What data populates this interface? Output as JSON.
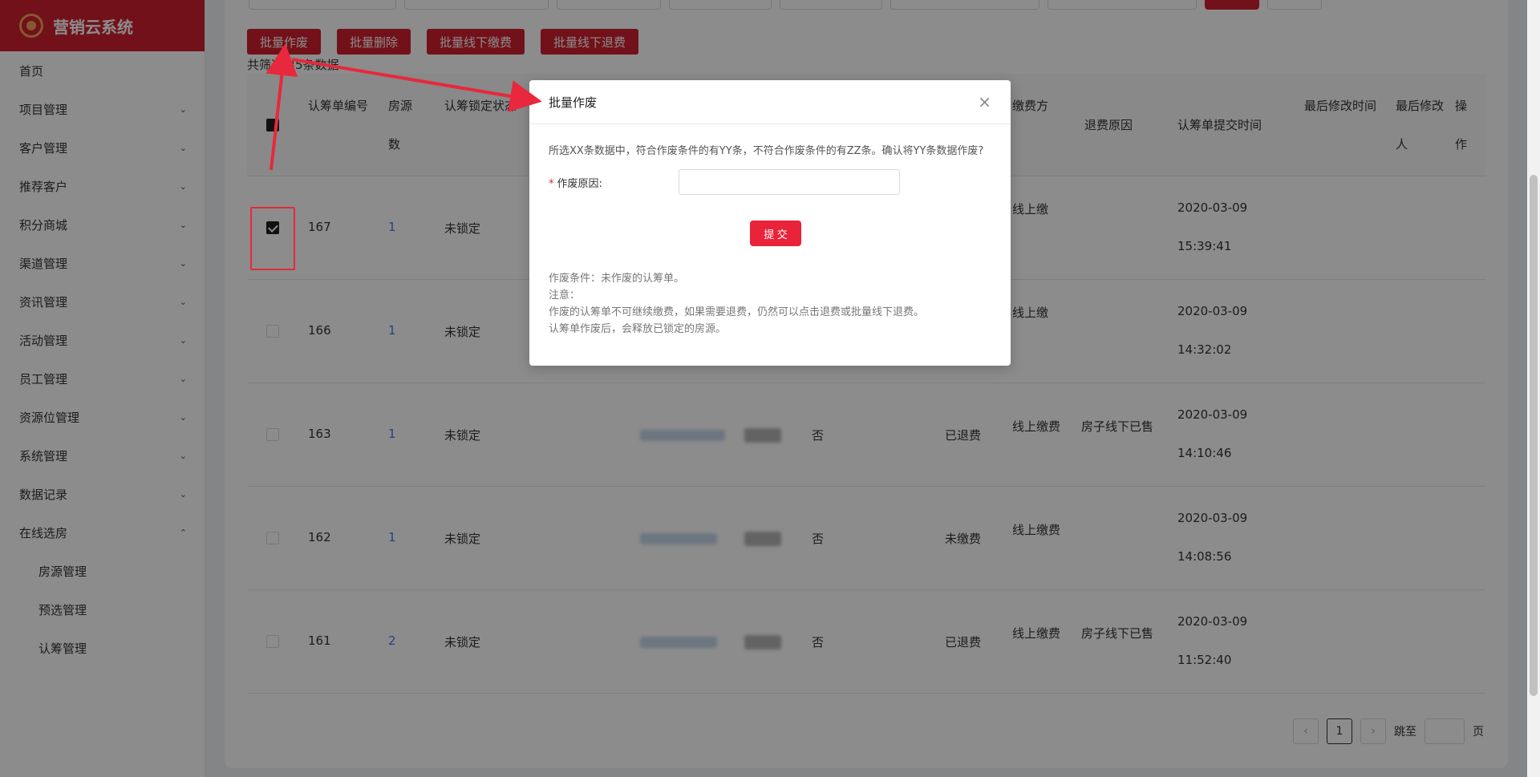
{
  "app": {
    "name": "营销云系统"
  },
  "sidebar": {
    "items": [
      {
        "label": "首页",
        "arrow": ""
      },
      {
        "label": "项目管理",
        "arrow": "⌄"
      },
      {
        "label": "客户管理",
        "arrow": "⌄"
      },
      {
        "label": "推荐客户",
        "arrow": "⌄"
      },
      {
        "label": "积分商城",
        "arrow": "⌄"
      },
      {
        "label": "渠道管理",
        "arrow": "⌄"
      },
      {
        "label": "资讯管理",
        "arrow": "⌄"
      },
      {
        "label": "活动管理",
        "arrow": "⌄"
      },
      {
        "label": "员工管理",
        "arrow": "⌄"
      },
      {
        "label": "资源位管理",
        "arrow": "⌄"
      },
      {
        "label": "系统管理",
        "arrow": "⌄"
      },
      {
        "label": "数据记录",
        "arrow": "⌄"
      },
      {
        "label": "在线选房",
        "arrow": "⌃"
      }
    ],
    "subitems": [
      {
        "label": "房源管理"
      },
      {
        "label": "预选管理"
      },
      {
        "label": "认筹管理"
      }
    ]
  },
  "toolbar": {
    "batch_void": "批量作废",
    "batch_delete": "批量删除",
    "batch_offline_pay": "批量线下缴费",
    "batch_offline_refund": "批量线下退费"
  },
  "summary": {
    "count_text": "共筛选出5条数据"
  },
  "table": {
    "headers": {
      "id": "认筹单编号",
      "rooms": "房源数",
      "lock": "认筹锁定状态",
      "pay_method": "缴费方",
      "refund_reason": "退费原因",
      "submit_time": "认筹单提交时间",
      "modified_time": "最后修改时间",
      "modified_by": "最后修改人",
      "op": "操作"
    },
    "rows": [
      {
        "id": "167",
        "rooms": "1",
        "lock": "未锁定",
        "flag": "",
        "status": "",
        "pay": "线上缴",
        "reason": "",
        "date": "2020-03-09",
        "time": "15:39:41",
        "checked": true
      },
      {
        "id": "166",
        "rooms": "1",
        "lock": "未锁定",
        "flag": "",
        "status": "",
        "pay": "线上缴",
        "reason": "",
        "date": "2020-03-09",
        "time": "14:32:02",
        "checked": false
      },
      {
        "id": "163",
        "rooms": "1",
        "lock": "未锁定",
        "flag": "否",
        "status": "已退费",
        "pay": "线上缴费",
        "reason": "房子线下已售",
        "date": "2020-03-09",
        "time": "14:10:46",
        "checked": false
      },
      {
        "id": "162",
        "rooms": "1",
        "lock": "未锁定",
        "flag": "否",
        "status": "未缴费",
        "pay": "线上缴费",
        "reason": "",
        "date": "2020-03-09",
        "time": "14:08:56",
        "checked": false
      },
      {
        "id": "161",
        "rooms": "2",
        "lock": "未锁定",
        "flag": "否",
        "status": "已退费",
        "pay": "线上缴费",
        "reason": "房子线下已售",
        "date": "2020-03-09",
        "time": "11:52:40",
        "checked": false
      }
    ]
  },
  "pager": {
    "prev": "‹",
    "current": "1",
    "next": "›",
    "jump_label": "跳至",
    "page_label": "页"
  },
  "modal": {
    "title": "批量作废",
    "close": "×",
    "message": "所选XX条数据中，符合作废条件的有YY条，不符合作废条件的有ZZ条。确认将YY条数据作废?",
    "required_mark": "*",
    "reason_label": "作废原因:",
    "reason_value": "",
    "submit_label": "提 交",
    "notes": [
      "作废条件：未作废的认筹单。",
      "注意：",
      "作废的认筹单不可继续缴费，如果需要退费，仍然可以点击退费或批量线下退费。",
      "认筹单作废后，会释放已锁定的房源。"
    ]
  },
  "colors": {
    "brand": "#d0202e",
    "annotation": "#e8283c",
    "link": "#3b7ff0"
  }
}
